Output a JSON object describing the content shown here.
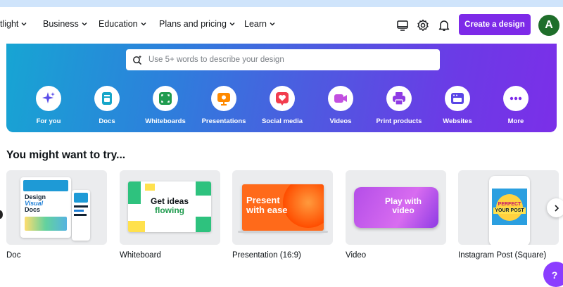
{
  "nav": {
    "items": [
      {
        "label": "tlight"
      },
      {
        "label": "Business"
      },
      {
        "label": "Education"
      },
      {
        "label": "Plans and pricing"
      },
      {
        "label": "Learn"
      }
    ],
    "create_button": "Create a design",
    "avatar_initial": "A"
  },
  "hero": {
    "search_placeholder": "Use 5+ words to describe your design",
    "categories": [
      {
        "label": "For you",
        "icon": "sparkle-icon",
        "color": "#5b4ee8"
      },
      {
        "label": "Docs",
        "icon": "doc-icon",
        "color": "#16a6c9"
      },
      {
        "label": "Whiteboards",
        "icon": "whiteboard-icon",
        "color": "#1f9b4e"
      },
      {
        "label": "Presentations",
        "icon": "presentation-icon",
        "color": "#ff8a00"
      },
      {
        "label": "Social media",
        "icon": "heart-icon",
        "color": "#f23d4e"
      },
      {
        "label": "Videos",
        "icon": "video-icon",
        "color": "#c24fe0"
      },
      {
        "label": "Print products",
        "icon": "print-icon",
        "color": "#8e3be4"
      },
      {
        "label": "Websites",
        "icon": "website-icon",
        "color": "#5a45e6"
      },
      {
        "label": "More",
        "icon": "more-icon",
        "color": "#7d2ae8"
      }
    ]
  },
  "section": {
    "title": "You might want to try..."
  },
  "cards": [
    {
      "label": "Doc",
      "thumb_text": [
        "Design",
        "Visual",
        "Docs"
      ]
    },
    {
      "label": "Whiteboard",
      "thumb_text": [
        "Get ideas",
        "flowing"
      ]
    },
    {
      "label": "Presentation (16:9)",
      "thumb_text": [
        "Present",
        "with ease"
      ]
    },
    {
      "label": "Video",
      "thumb_text": [
        "Play with",
        "video"
      ]
    },
    {
      "label": "Instagram Post (Square)",
      "thumb_text": [
        "PERFECT",
        "YOUR POST"
      ]
    }
  ],
  "help": {
    "label": "?"
  }
}
